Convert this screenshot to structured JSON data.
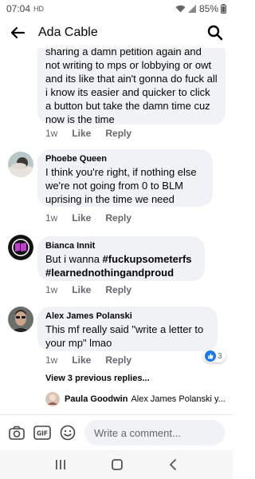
{
  "status": {
    "time": "07:04",
    "carrier": "HD",
    "battery": "85%"
  },
  "header": {
    "title": "Ada Cable"
  },
  "first_comment": {
    "lines": "sharing a damn petition again and not writing to mps or lobbying or owt and its like that ain't gonna do fuck all i know its easier and quicker to click a button but take the damn time cuz now is the time",
    "time": "1w",
    "like": "Like",
    "reply": "Reply"
  },
  "comments": [
    {
      "author": "Phoebe Queen",
      "text": "I think you're right, if nothing else we're not going from 0 to BLM uprising in the time we need",
      "time": "1w",
      "like": "Like",
      "reply": "Reply"
    },
    {
      "author": "Bianca Innit",
      "text_prefix": "But i wanna ",
      "hashtag1": "#fuckupsometerfs",
      "hashtag2": "#learnednothingandproud",
      "time": "1w",
      "like": "Like",
      "reply": "Reply"
    },
    {
      "author": "Alex James Polanski",
      "text": "This mf really said \"write a letter to your mp\" lmao",
      "time": "1w",
      "like": "Like",
      "reply": "Reply",
      "reaction_count": "3"
    }
  ],
  "view_previous": "View 3 previous replies...",
  "latest_reply": {
    "author": "Paula Goodwin",
    "preview": "Alex James Polanski y..."
  },
  "composer": {
    "placeholder": "Write a comment..."
  },
  "colors": {
    "bubble": "#f0f2f5",
    "like_blue": "#1877f2",
    "meta_gray": "#65676b"
  }
}
